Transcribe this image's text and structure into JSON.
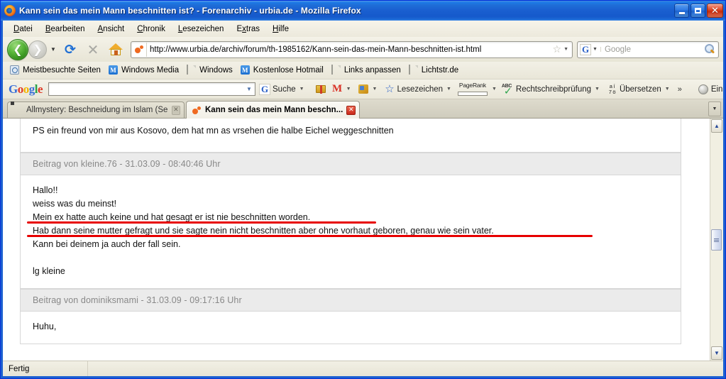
{
  "window": {
    "title": "Kann sein das mein Mann beschnitten ist? - Forenarchiv - urbia.de - Mozilla Firefox",
    "minimize_label": "",
    "maximize_label": "",
    "close_label": "✕"
  },
  "menubar": {
    "items": [
      {
        "label": "Datei",
        "accel": "D"
      },
      {
        "label": "Bearbeiten",
        "accel": "B"
      },
      {
        "label": "Ansicht",
        "accel": "A"
      },
      {
        "label": "Chronik",
        "accel": "C"
      },
      {
        "label": "Lesezeichen",
        "accel": "L"
      },
      {
        "label": "Extras",
        "accel": "x"
      },
      {
        "label": "Hilfe",
        "accel": "H"
      }
    ]
  },
  "navbar": {
    "back_glyph": "❮",
    "forward_glyph": "❯",
    "dropdown_glyph": "▼",
    "reload_glyph": "⟳",
    "stop_glyph": "✕",
    "url": "http://www.urbia.de/archiv/forum/th-1985162/Kann-sein-das-mein-Mann-beschnitten-ist.html",
    "star_glyph": "☆",
    "url_dropdown_glyph": "▼",
    "search_engine": "G",
    "search_placeholder": "Google",
    "search_dropdown_glyph": "▼"
  },
  "bookmarks": {
    "items": [
      {
        "label": "Meistbesuchte Seiten",
        "icon": "history-folder-icon"
      },
      {
        "label": "Windows Media",
        "icon": "media-icon"
      },
      {
        "label": "Windows",
        "icon": "page-icon"
      },
      {
        "label": "Kostenlose Hotmail",
        "icon": "media-icon"
      },
      {
        "label": "Links anpassen",
        "icon": "page-icon"
      },
      {
        "label": "Lichtstr.de",
        "icon": "page-icon"
      }
    ]
  },
  "google_toolbar": {
    "logo": {
      "g1": "G",
      "o1": "o",
      "o2": "o",
      "g2": "g",
      "l": "l",
      "e": "e"
    },
    "search_value": "",
    "search_button": "Suche",
    "bookmarks_button": "Lesezeichen",
    "pagerank_label": "PageRank",
    "spellcheck_button": "Rechtschreibprüfung",
    "translate_button": "Übersetzen",
    "translate_icon_top": "a í",
    "translate_icon_bottom": "7 ö",
    "more_button": "»",
    "settings_button": "Einstellungen",
    "caret": "▼",
    "abc_label": "ABC"
  },
  "tabs": [
    {
      "label": "Allmystery: Beschneidung im Islam (Seit...",
      "active": false,
      "close_glyph": "✕",
      "icon": "allmystery-favicon"
    },
    {
      "label": "Kann sein das mein Mann beschn...",
      "active": true,
      "close_glyph": "✕",
      "icon": "urbia-favicon"
    }
  ],
  "tab_list_glyph": "▼",
  "page": {
    "posts": [
      {
        "header": null,
        "lines": [
          {
            "text": "PS ein freund von mir aus Kosovo, dem hat mn as vrsehen die halbe Eichel weggeschnitten",
            "underline": null
          }
        ]
      },
      {
        "header": "Beitrag von kleine.76 - 31.03.09 - 08:40:46 Uhr",
        "lines": [
          {
            "text": "Hallo!!",
            "underline": null
          },
          {
            "text": "weiss was du meinst!",
            "underline": null
          },
          {
            "text": "Mein ex hatte auch keine und hat gesagt er ist nie beschnitten worden.",
            "underline": "short"
          },
          {
            "text": "Hab dann seine mutter gefragt und sie sagte nein nicht beschnitten aber ohne vorhaut geboren, genau wie sein vater.",
            "underline": "long"
          },
          {
            "text": "Kann bei deinem ja auch der fall sein.",
            "underline": null
          },
          {
            "text": "",
            "underline": null
          },
          {
            "text": "lg kleine",
            "underline": null
          }
        ]
      },
      {
        "header": "Beitrag von dominiksmami - 31.03.09 - 09:17:16 Uhr",
        "lines": [
          {
            "text": "Huhu,",
            "underline": null
          }
        ]
      }
    ]
  },
  "scrollbar": {
    "up_glyph": "▲",
    "down_glyph": "▼",
    "thumb_top_pct": 50
  },
  "statusbar": {
    "text": "Fertig"
  },
  "colors": {
    "titlebar_blue": "#1a5fd0",
    "highlight_red": "#e70000",
    "post_header_bg": "#ebebeb",
    "chrome_bg": "#f0eee2"
  }
}
